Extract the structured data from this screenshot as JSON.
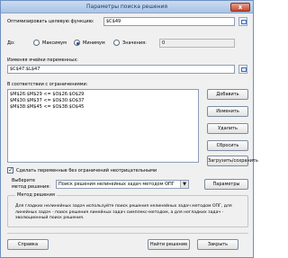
{
  "window": {
    "title": "Параметры поиска решения",
    "close_glyph": "x"
  },
  "objective": {
    "label": "Оптимизировать целевую функцию:",
    "value": "$C$49"
  },
  "direction": {
    "label": "До:",
    "options": [
      {
        "label": "Максимум",
        "selected": false
      },
      {
        "label": "Минимум",
        "selected": true
      },
      {
        "label": "Значения:",
        "selected": false
      }
    ],
    "value_field": "0"
  },
  "variables": {
    "label": "Изменяя ячейки переменных:",
    "value": "$C$47:$L$47"
  },
  "constraints": {
    "label": "В соответствии с ограничениями:",
    "items": [
      "$M$26:$M$29 <= $O$26:$O$29",
      "$M$30:$M$37 <= $O$30:$O$37",
      "$M$38:$M$45 <= $O$38:$O$45"
    ]
  },
  "constraint_buttons": {
    "add": "Добавить",
    "change": "Изменить",
    "delete": "Удалить",
    "reset": "Сбросить",
    "load_save": "Загрузить/сохранить"
  },
  "nonneg_checkbox": {
    "label": "Сделать переменные без ограничений неотрицательными",
    "checked": true
  },
  "method": {
    "label_line1": "Выберите",
    "label_line2": "метод решения:",
    "selected": "Поиск решения нелинейных задач методом ОПГ",
    "params_button": "Параметры"
  },
  "method_group": {
    "title": "Метод решения",
    "description": "Для гладких нелинейных задач используйте поиск решения нелинейных задач методом ОПГ, для линейных задач - поиск решения линейных задач симплекс-методом, а для негладких задач - эволюционный поиск решения."
  },
  "footer": {
    "help": "Справка",
    "solve": "Найти решение",
    "close": "Закрыть"
  },
  "icons": {
    "close": "close-icon",
    "range_picker": "range-picker-icon",
    "dropdown": "chevron-down-icon"
  }
}
